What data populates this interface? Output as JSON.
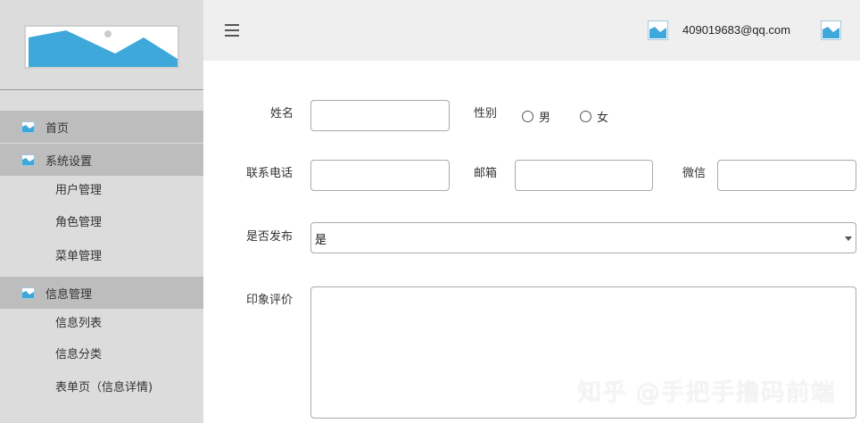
{
  "header": {
    "user_email": "409019683@qq.com"
  },
  "sidebar": {
    "sections": [
      {
        "label": "首页",
        "icon": "image-icon",
        "children": []
      },
      {
        "label": "系统设置",
        "icon": "image-icon",
        "children": [
          "用户管理",
          "角色管理",
          "菜单管理"
        ]
      },
      {
        "label": "信息管理",
        "icon": "image-icon",
        "children": [
          "信息列表",
          "信息分类",
          "表单页（信息详情)"
        ]
      }
    ]
  },
  "form": {
    "name_label": "姓名",
    "name_value": "",
    "gender_label": "性别",
    "gender_options": [
      "男",
      "女"
    ],
    "phone_label": "联系电话",
    "phone_value": "",
    "email_label": "邮箱",
    "email_value": "",
    "wechat_label": "微信",
    "wechat_value": "",
    "publish_label": "是否发布",
    "publish_value": "是",
    "impression_label": "印象评价",
    "impression_value": ""
  },
  "watermark": "知乎 @手把手撸码前端",
  "colors": {
    "sidebar_bg": "#dcdcdc",
    "sidebar_active": "#bdbdbd",
    "header_bg": "#efefef",
    "icon_blue": "#3ea8da"
  }
}
